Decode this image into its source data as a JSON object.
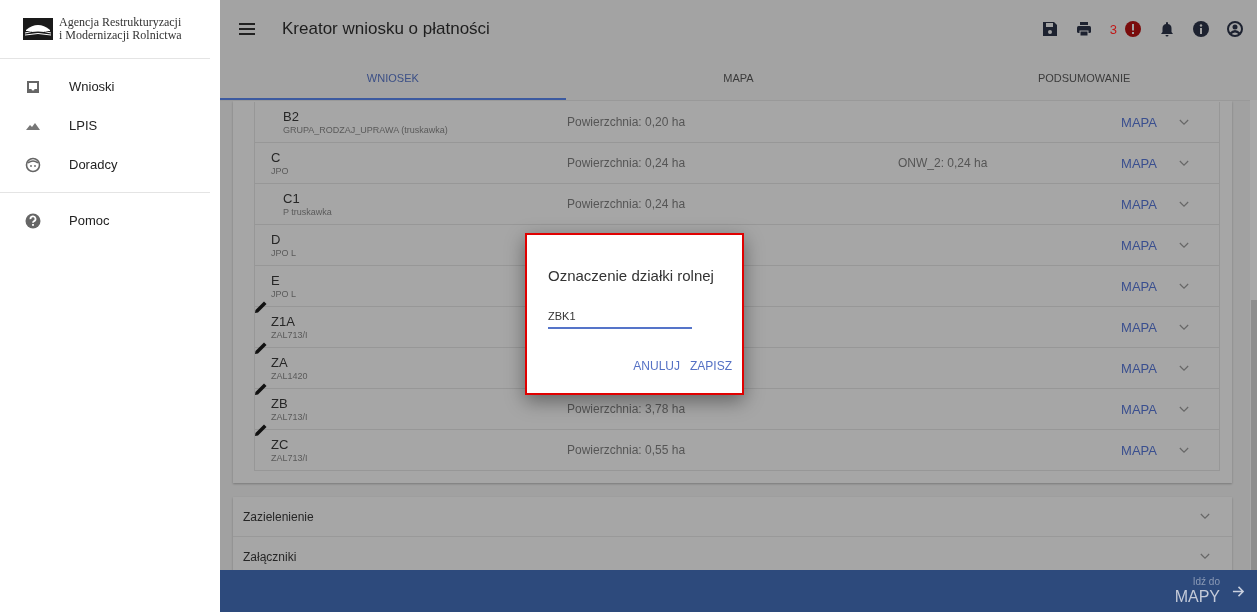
{
  "sidebar": {
    "logo_lines": [
      "Agencja Restrukturyzacji",
      "i Modernizacji Rolnictwa"
    ],
    "items": [
      {
        "label": "Wnioski"
      },
      {
        "label": "LPIS"
      },
      {
        "label": "Doradcy"
      }
    ],
    "help_items": [
      {
        "label": "Pomoc"
      }
    ]
  },
  "header": {
    "title": "Kreator wniosku o płatności",
    "alert_count": "3"
  },
  "tabs": [
    {
      "label": "WNIOSEK",
      "selected": true
    },
    {
      "label": "MAPA",
      "selected": false
    },
    {
      "label": "PODSUMOWANIE",
      "selected": false
    }
  ],
  "parcels": [
    {
      "children": [
        {
          "name": "B2",
          "tag": "GRUPA_RODZAJ_UPRAWA (truskawka)",
          "area": "Powierzchnia: 0,20 ha",
          "link": "MAPA",
          "editable": false
        }
      ]
    },
    {
      "name": "C",
      "tag": "JPO",
      "area": "Powierzchnia: 0,24 ha",
      "extra": "ONW_2: 0,24 ha",
      "link": "MAPA",
      "editable": false,
      "children": [
        {
          "name": "C1",
          "tag": "P truskawka",
          "area": "Powierzchnia: 0,24 ha",
          "link": "MAPA",
          "editable": false
        }
      ]
    },
    {
      "name": "D",
      "tag": "JPO L",
      "link": "MAPA",
      "editable": false
    },
    {
      "name": "E",
      "tag": "JPO L",
      "link": "MAPA",
      "editable": false
    },
    {
      "name": "Z1A",
      "tag": "ZAL713/I",
      "link": "MAPA",
      "editable": true
    },
    {
      "name": "ZA",
      "tag": "ZAL1420",
      "link": "MAPA",
      "editable": true
    },
    {
      "name": "ZB",
      "tag": "ZAL713/I",
      "area": "Powierzchnia: 3,78 ha",
      "link": "MAPA",
      "editable": true
    },
    {
      "name": "ZC",
      "tag": "ZAL713/I",
      "area": "Powierzchnia: 0,55 ha",
      "link": "MAPA",
      "editable": true
    }
  ],
  "sections": [
    {
      "label": "Zazielenienie",
      "expanded": false
    },
    {
      "label": "Załączniki",
      "expanded": false
    }
  ],
  "footer": {
    "caption": "Idź do",
    "target": "MAPY"
  },
  "dialog": {
    "title": "Oznaczenie działki rolnej",
    "value": "ZBK1",
    "buttons": [
      "ANULUJ",
      "ZAPISZ"
    ]
  }
}
